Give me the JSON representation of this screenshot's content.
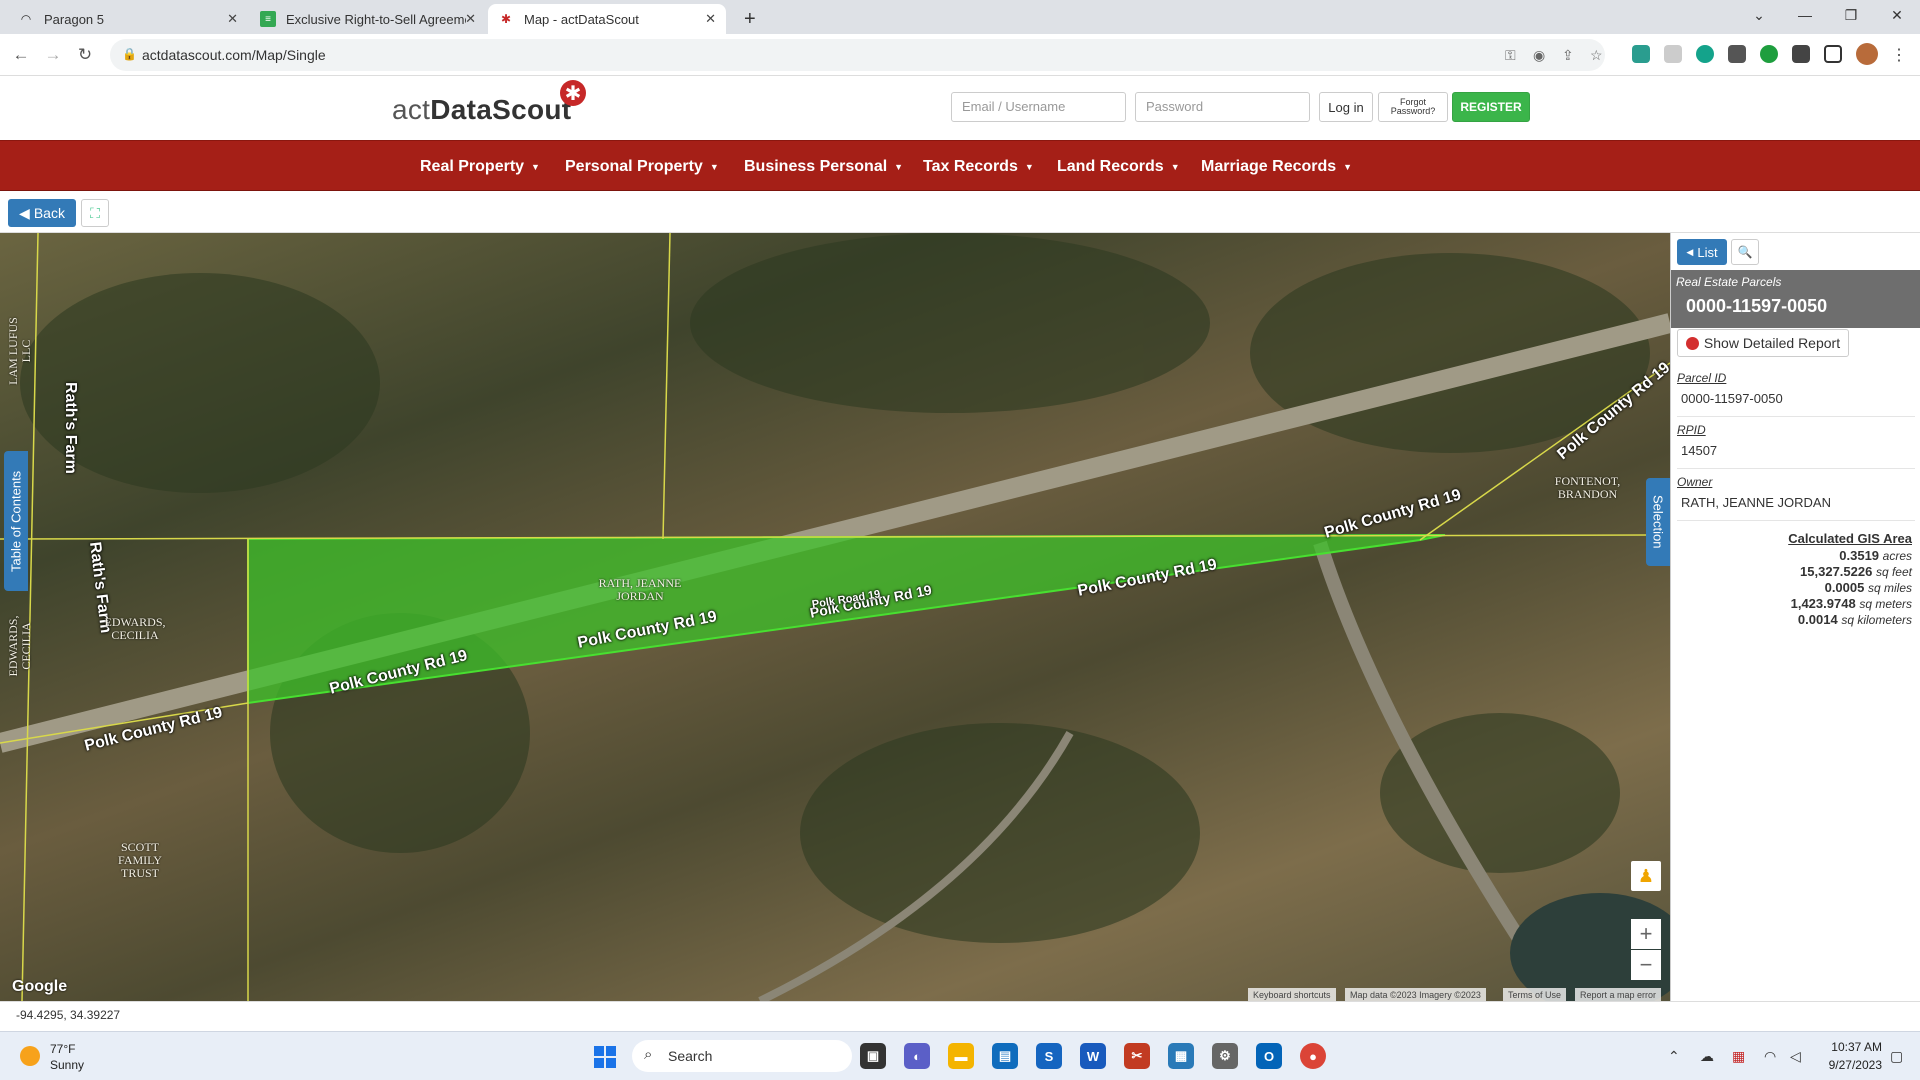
{
  "browser": {
    "tabs": [
      {
        "label": "Paragon 5",
        "icon": "paragon-icon"
      },
      {
        "label": "Exclusive Right-to-Sell Agreemen",
        "icon": "doc-icon"
      },
      {
        "label": "Map - actDataScout",
        "icon": "datascout-icon"
      }
    ],
    "url": "actdatascout.com/Map/Single"
  },
  "header": {
    "logo_prefix": "act",
    "logo_bold": "DataScout",
    "email_placeholder": "Email / Username",
    "password_placeholder": "Password",
    "login_label": "Log in",
    "forgot_label_1": "Forgot",
    "forgot_label_2": "Password?",
    "register_label": "REGISTER"
  },
  "nav": {
    "items": [
      {
        "label": "Real Property"
      },
      {
        "label": "Personal Property"
      },
      {
        "label": "Business Personal"
      },
      {
        "label": "Tax Records"
      },
      {
        "label": "Land Records"
      },
      {
        "label": "Marriage Records"
      }
    ]
  },
  "toolbar": {
    "back_label": "Back"
  },
  "map": {
    "road_labels": [
      "Polk County Rd 19",
      "Polk County Rd 19",
      "Polk County Rd 19",
      "Polk County Rd 19",
      "Polk County Rd 19",
      "Polk Road 19",
      "Polk County Rd 19",
      "Polk County Rd 19"
    ],
    "farm_labels": [
      "Rath's Farm",
      "Rath's Farm"
    ],
    "owner_labels": {
      "rath_1": "RATH, JEANNE",
      "rath_2": "JORDAN",
      "edwards_1": "EDWARDS,",
      "edwards_2": "CECILIA",
      "scott_1": "SCOTT",
      "scott_2": "FAMILY",
      "scott_3": "TRUST",
      "fontenot_1": "FONTENOT,",
      "fontenot_2": "BRANDON",
      "edge_left_1": "LAM LUFUS",
      "edge_left_2": "LLC",
      "edge_left_3": "EDWARDS,",
      "edge_left_4": "CECILIA"
    },
    "toc_label": "Table of Contents",
    "selection_label": "Selection",
    "google_label": "Google",
    "footer": [
      "Keyboard shortcuts",
      "Map data ©2023 Imagery ©2023",
      "Terms of Use",
      "Report a map error"
    ],
    "highlight_color": "#3ec22a"
  },
  "panel": {
    "list_label": "List",
    "category": "Real Estate Parcels",
    "parcel_number": "0000-11597-0050",
    "report_label": "Show Detailed Report",
    "parcel_id_label": "Parcel ID",
    "parcel_id_value": "0000-11597-0050",
    "rpid_label": "RPID",
    "rpid_value": "14507",
    "owner_label": "Owner",
    "owner_value": "RATH, JEANNE JORDAN",
    "gis_title": "Calculated GIS Area",
    "gis_rows": [
      {
        "value": "0.3519",
        "unit": "acres"
      },
      {
        "value": "15,327.5226",
        "unit": "sq feet"
      },
      {
        "value": "0.0005",
        "unit": "sq miles"
      },
      {
        "value": "1,423.9748",
        "unit": "sq meters"
      },
      {
        "value": "0.0014",
        "unit": "sq kilometers"
      }
    ]
  },
  "status": {
    "coords": "-94.4295, 34.39227"
  },
  "taskbar": {
    "temp": "77°F",
    "condition": "Sunny",
    "search_label": "Search",
    "time": "10:37 AM",
    "date": "9/27/2023"
  }
}
